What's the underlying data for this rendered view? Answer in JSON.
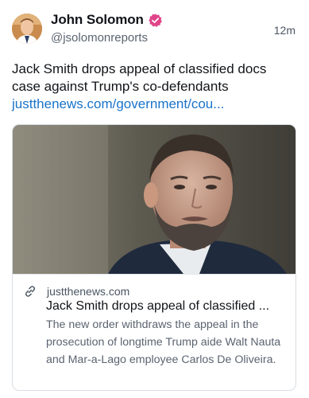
{
  "author": {
    "display_name": "John Solomon",
    "handle": "@jsolomonreports",
    "avatar_icon": "avatar-photo",
    "verified_icon": "verified-badge-icon",
    "verified_color": "#e0458a"
  },
  "post": {
    "time": "12m",
    "text": "Jack Smith drops appeal of classified docs case against Trump's co-defendants",
    "link_text": "justthenews.com/government/cou..."
  },
  "card": {
    "image_icon": "article-photo",
    "domain_icon": "link-icon",
    "domain": "justthenews.com",
    "title": "Jack Smith drops appeal of classified ...",
    "description": "The new order withdraws the appeal in the prosecution of longtime Trump aide Walt Nauta and Mar-a-Lago employee Carlos De Oliveira."
  },
  "colors": {
    "link": "#1a73c9",
    "text": "#111418",
    "secondary": "#5b6470"
  }
}
